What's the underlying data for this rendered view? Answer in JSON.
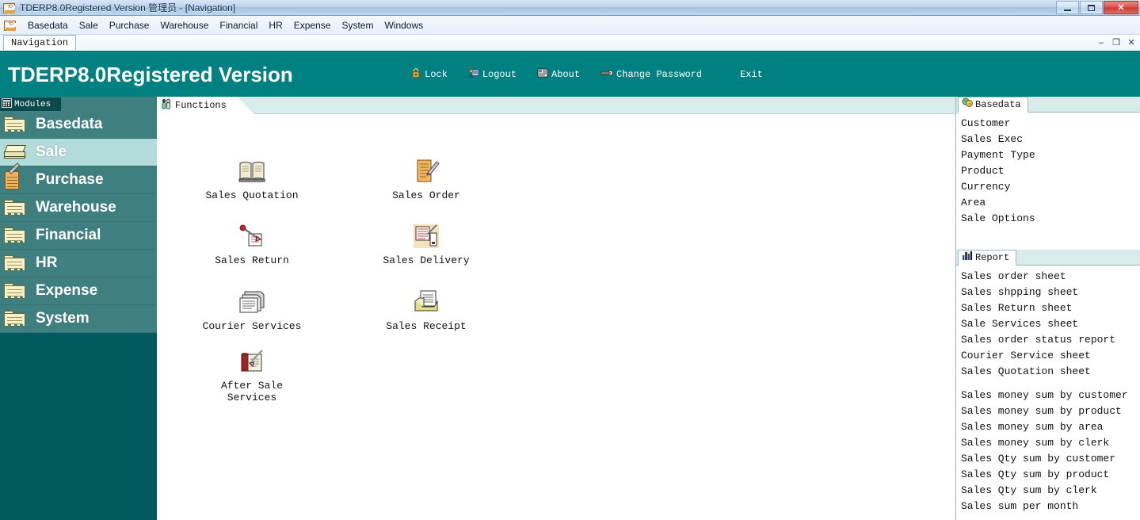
{
  "window": {
    "title": "TDERP8.0Registered Version 管理员 - [Navigation]",
    "app_icon": "tderp-app-icon",
    "minimize_label": "–",
    "maximize_label": "❐",
    "close_label": "✕"
  },
  "menubar": {
    "icon": "tderp-menu-icon",
    "items": [
      {
        "label": "Basedata"
      },
      {
        "label": "Sale"
      },
      {
        "label": "Purchase"
      },
      {
        "label": "Warehouse"
      },
      {
        "label": "Financial"
      },
      {
        "label": "HR"
      },
      {
        "label": "Expense"
      },
      {
        "label": "System"
      },
      {
        "label": "Windows"
      }
    ]
  },
  "mdi": {
    "tab_label": "Navigation",
    "minimize_label": "–",
    "restore_label": "❐",
    "close_label": "✕"
  },
  "banner": {
    "title": "TDERP8.0Registered Version",
    "background": "#008080",
    "actions": [
      {
        "label": "Lock",
        "icon": "padlock-icon"
      },
      {
        "label": "Logout",
        "icon": "logout-icon"
      },
      {
        "label": "About",
        "icon": "about-info-icon"
      },
      {
        "label": "Change Password",
        "icon": "key-icon"
      },
      {
        "label": "Exit",
        "icon": ""
      }
    ]
  },
  "sidebar": {
    "tab_label": "Modules",
    "tab_icon": "modules-grid-icon",
    "background": "#00595c",
    "item_background": "#3f7f7f",
    "active_background": "#b3dbd9",
    "items": [
      {
        "label": "Basedata",
        "icon": "folder-icon",
        "active": false
      },
      {
        "label": "Sale",
        "icon": "sale-stack-icon",
        "active": true
      },
      {
        "label": "Purchase",
        "icon": "notepad-pencil-icon",
        "active": false
      },
      {
        "label": "Warehouse",
        "icon": "folder-icon",
        "active": false
      },
      {
        "label": "Financial",
        "icon": "folder-icon",
        "active": false
      },
      {
        "label": "HR",
        "icon": "folder-icon",
        "active": false
      },
      {
        "label": "Expense",
        "icon": "folder-icon",
        "active": false
      },
      {
        "label": "System",
        "icon": "folder-icon",
        "active": false
      }
    ]
  },
  "functions": {
    "tab_label": "Functions",
    "tab_icon": "functions-people-icon",
    "items": [
      {
        "label": "Sales Quotation",
        "icon": "open-book-icon"
      },
      {
        "label": "Sales Order",
        "icon": "notepad-pencil-icon"
      },
      {
        "label": "Sales Return",
        "icon": "return-pen-icon"
      },
      {
        "label": "Sales Delivery",
        "icon": "delivery-note-icon"
      },
      {
        "label": "Courier Services",
        "icon": "stacked-papers-icon"
      },
      {
        "label": "Sales Receipt",
        "icon": "receipt-tray-icon"
      },
      {
        "label": "After Sale\nServices",
        "icon": "service-book-pen-icon"
      }
    ]
  },
  "basedata_panel": {
    "tab_label": "Basedata",
    "tab_icon": "basedata-spheres-icon",
    "items": [
      {
        "label": "Customer"
      },
      {
        "label": "Sales Exec"
      },
      {
        "label": "Payment Type"
      },
      {
        "label": "Product"
      },
      {
        "label": "Currency"
      },
      {
        "label": "Area"
      },
      {
        "label": "Sale Options"
      }
    ]
  },
  "report_panel": {
    "tab_label": "Report",
    "tab_icon": "report-bars-icon",
    "group1": [
      {
        "label": "Sales order sheet"
      },
      {
        "label": "Sales shpping sheet"
      },
      {
        "label": "Sales Return sheet"
      },
      {
        "label": "Sale Services sheet"
      },
      {
        "label": "Sales order status report"
      },
      {
        "label": "Courier Service sheet"
      },
      {
        "label": "Sales Quotation sheet"
      }
    ],
    "group2": [
      {
        "label": "Sales money sum by customer"
      },
      {
        "label": "Sales money sum by product"
      },
      {
        "label": "Sales money sum by area"
      },
      {
        "label": "Sales money sum by clerk"
      },
      {
        "label": "Sales Qty sum by customer"
      },
      {
        "label": "Sales Qty sum by product"
      },
      {
        "label": "Sales Qty sum by clerk"
      },
      {
        "label": "Sales sum per month"
      }
    ]
  }
}
